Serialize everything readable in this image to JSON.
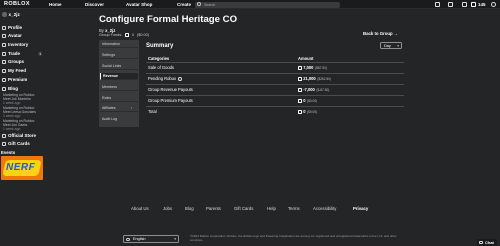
{
  "topbar": {
    "logo": "ROBLOX",
    "nav": [
      "Home",
      "Discover",
      "Avatar Shop",
      "Create"
    ],
    "search_placeholder": "Search",
    "robux_count": "145"
  },
  "sidebar": {
    "username": "x_2jz",
    "items": [
      {
        "label": "Profile",
        "icon": "profile-icon"
      },
      {
        "label": "Avatar",
        "icon": "avatar-icon"
      },
      {
        "label": "Inventory",
        "icon": "inventory-icon"
      },
      {
        "label": "Trade",
        "icon": "trade-icon"
      },
      {
        "label": "Groups",
        "icon": "groups-icon"
      },
      {
        "label": "My Feed",
        "icon": "feed-icon"
      },
      {
        "label": "Premium",
        "icon": "premium-icon"
      },
      {
        "label": "Blog",
        "icon": "blog-icon"
      }
    ],
    "trade_count": "1",
    "blog_posts": [
      {
        "title": "Marketing on Roblox: Meet Jok Monteiro",
        "time": "1 week ago"
      },
      {
        "title": "Marketing on Roblox: Meet Leesa Gonzales",
        "time": "1 week ago"
      },
      {
        "title": "Marketing on Roblox: Meet Jon Gaeta",
        "time": "1 week ago"
      }
    ],
    "bottom_items": [
      {
        "label": "Official Store",
        "icon": "store-icon"
      },
      {
        "label": "Gift Cards",
        "icon": "gift-icon"
      }
    ],
    "events_label": "Events",
    "event_banner": "NERF"
  },
  "page": {
    "title": "Configure Formal Heritage CO",
    "owner_prefix": "By",
    "owner": "x_2jz",
    "funds_label": "Group Funds:",
    "funds_value": "0",
    "funds_usd": "($0.00)",
    "back_link": "Back to Group →"
  },
  "config_menu": [
    "Information",
    "Settings",
    "Social Links",
    "Revenue",
    "Members",
    "Roles",
    "Affiliates",
    "Audit Log"
  ],
  "affiliates_arrow": "›",
  "summary": {
    "title": "Summary",
    "period": "Day",
    "col_categories": "Categories",
    "col_amount": "Amount",
    "rows": [
      {
        "label": "Sale of Goods",
        "amount": "7,000",
        "usd": "($87.50)"
      },
      {
        "label": "Pending Robux",
        "amount": "21,000",
        "usd": "($262.50)"
      },
      {
        "label": "Group Revenue Payouts",
        "amount": "-7,000",
        "usd": "($-87.50)"
      },
      {
        "label": "Group Premium Payouts",
        "amount": "0",
        "usd": "($0.00)"
      },
      {
        "label": "Total",
        "amount": "0",
        "usd": "($0.00)"
      }
    ]
  },
  "footer": {
    "links": [
      "About Us",
      "Jobs",
      "Blog",
      "Parents",
      "Gift Cards",
      "Help",
      "Terms",
      "Accessibility",
      "Privacy"
    ],
    "language": "English",
    "copyright": "©2023 Roblox Corporation. Roblox, the Roblox logo and Powering Imagination are among our registered and unregistered trademarks in the U.S. and other countries."
  },
  "chat_label": "Chat"
}
